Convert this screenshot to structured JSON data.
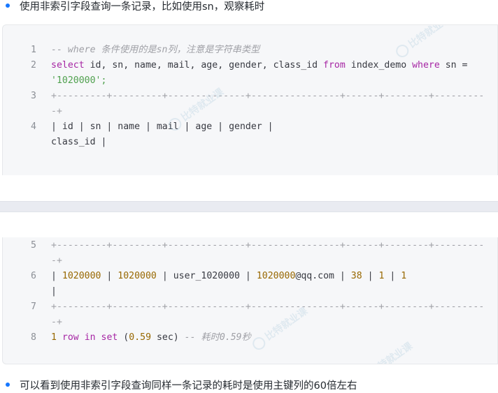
{
  "bullets": {
    "top": "使用非索引字段查询一条记录，比如使用sn，观察耗时",
    "bottom": "可以看到使用非索引字段查询同样一条记录的耗时是使用主键列的60倍左右"
  },
  "code_block_1": {
    "lines": [
      {
        "number": "1",
        "text": [
          "-- where 条件使用的是sn列，注意是字符串类型"
        ]
      },
      {
        "number": "2",
        "text": [
          "select id, sn, name, mail, age, gender, class_id from index_demo where sn =",
          "'1020000';"
        ]
      },
      {
        "number": "3",
        "text": [
          "+---------+---------+--------------+----------------+------+--------+---------",
          "-+"
        ]
      },
      {
        "number": "4",
        "text": [
          "| id      | sn      | name         | mail           | age  | gender |",
          "class_id |"
        ]
      }
    ]
  },
  "code_block_2": {
    "lines": [
      {
        "number": "5",
        "text": [
          "+---------+---------+--------------+----------------+------+--------+---------",
          "-+"
        ]
      },
      {
        "number": "6",
        "text": [
          "| 1020000 | 1020000 | user_1020000 | 1020000@qq.com |   38 |      1 |        1",
          "|"
        ]
      },
      {
        "number": "7",
        "text": [
          "+---------+---------+--------------+----------------+------+--------+---------",
          "-+"
        ]
      },
      {
        "number": "8",
        "text": [
          "1 row in set (0.59 sec) -- 耗时0.59秒"
        ]
      }
    ]
  },
  "watermark": {
    "text": "比特就业课"
  },
  "colors": {
    "bullet": "#1677ff",
    "keyword": "#a626a4",
    "string": "#50a14f",
    "number": "#986801",
    "comment": "#a0a1a7",
    "code_bg": "#f6f7f9"
  }
}
